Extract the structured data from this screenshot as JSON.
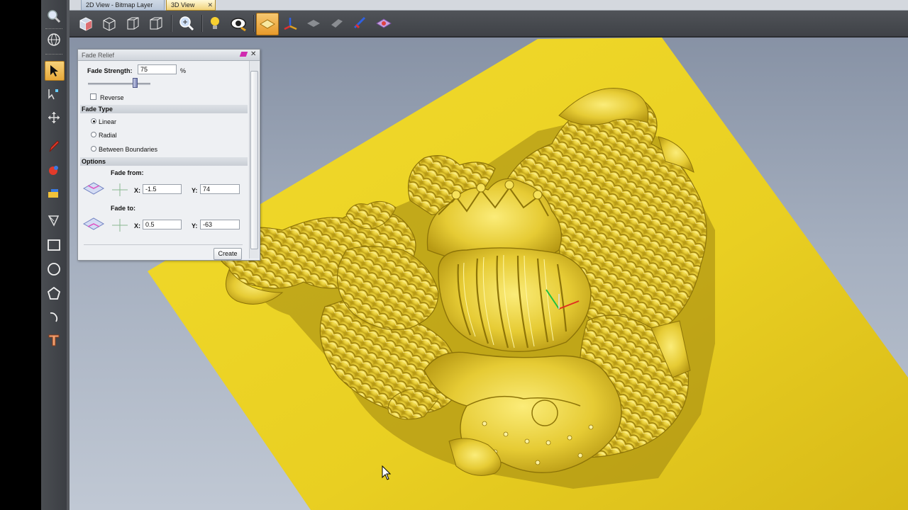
{
  "tabs": [
    {
      "label": "2D View - Bitmap Layer"
    },
    {
      "label": "3D View",
      "active": true
    }
  ],
  "left_toolbar": {
    "icons": [
      "zoom-icon",
      "globe-icon",
      "select-arrow-icon",
      "node-edit-icon",
      "transform-icon",
      "pencil-icon",
      "paint-icon",
      "bitmap-icon",
      "vector-icon",
      "rectangle-icon",
      "circle-icon",
      "polygon-icon",
      "arc-icon",
      "text-icon"
    ]
  },
  "top_toolbar": {
    "icons": [
      "iso-view-icon",
      "front-view-icon",
      "side-view-icon",
      "top-view-icon",
      "zoom-fit-icon",
      "light-icon",
      "eye-icon",
      "relief-plane-icon",
      "axes-icon",
      "shade-icon",
      "wire-icon",
      "color-icon",
      "material-icon"
    ]
  },
  "fade_panel": {
    "title": "Fade Relief",
    "fade_strength_label": "Fade Strength:",
    "fade_strength_value": "75",
    "fade_strength_unit": "%",
    "fade_strength_slider": 0.75,
    "reverse_label": "Reverse",
    "reverse_checked": false,
    "fade_type_header": "Fade Type",
    "fade_types": [
      "Linear",
      "Radial",
      "Between Boundaries"
    ],
    "fade_type_selected": "Linear",
    "options_header": "Options",
    "fade_from_label": "Fade from:",
    "fade_from_x_label": "X:",
    "fade_from_x": "-1.5",
    "fade_from_y_label": "Y:",
    "fade_from_y": "74",
    "fade_to_label": "Fade to:",
    "fade_to_x_label": "X:",
    "fade_to_x": "0.5",
    "fade_to_y_label": "Y:",
    "fade_to_y": "-63",
    "create_label": "Create"
  },
  "colors": {
    "relief_gold": "#e6cf2a",
    "relief_shadow": "#a88f10",
    "relief_highlight": "#fff6a0",
    "viewport_bg": "#a5afbf"
  }
}
